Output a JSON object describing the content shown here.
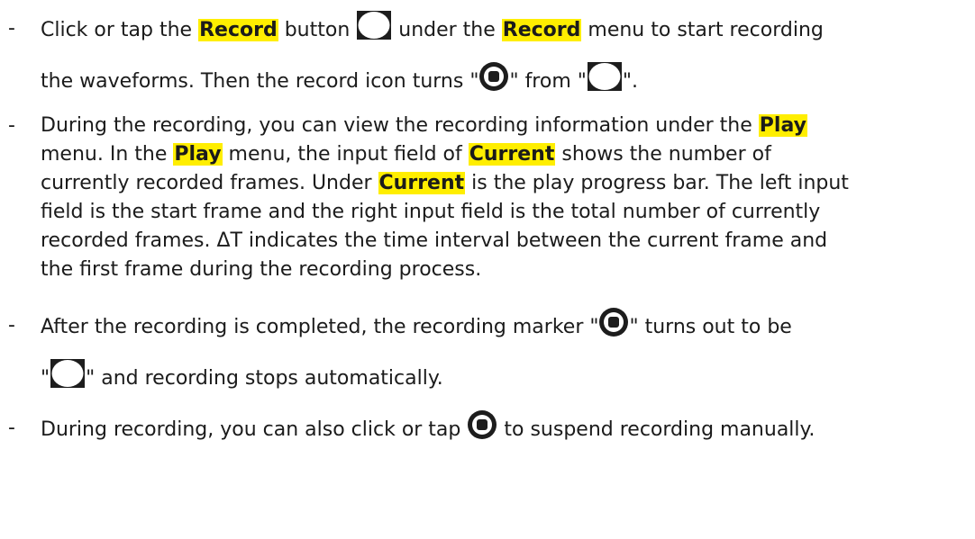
{
  "bullets": [
    {
      "lines": [
        {
          "parts": [
            "Click or tap the ",
            "Record",
            " button ",
            "",
            " under the ",
            "Record",
            " menu to start recording"
          ]
        },
        {
          "parts": [
            "the waveforms. Then the record icon turns \"",
            "",
            "\" from \"",
            "",
            "\"."
          ]
        }
      ]
    },
    {
      "lines": [
        {
          "parts": [
            "During the recording, you can view the recording information under the ",
            "Play"
          ]
        },
        {
          "parts": [
            "menu. In the ",
            "Play",
            " menu, the input field of ",
            "Current",
            " shows the number of"
          ]
        },
        {
          "parts": [
            "currently recorded frames. Under ",
            "Current",
            " is the play progress bar. The left input"
          ]
        },
        {
          "text": "field is the start frame and the right input field is the total number of currently"
        },
        {
          "text": "recorded frames. ΔT indicates the time interval between the current frame and"
        },
        {
          "text": "the first frame during the recording process."
        }
      ]
    },
    {
      "lines": [
        {
          "parts": [
            "After the recording is completed, the recording marker \"",
            "",
            "\" turns out to be"
          ]
        },
        {
          "parts": [
            "\"",
            "",
            "\" and recording stops automatically."
          ]
        }
      ]
    },
    {
      "lines": [
        {
          "parts": [
            "During recording, you can also click or tap ",
            "",
            " to suspend recording manually."
          ]
        }
      ]
    }
  ],
  "dash": "-",
  "icons": {
    "idle": "record-idle-icon",
    "active": "record-active-icon"
  },
  "colors": {
    "highlight": "#ffee00",
    "icon_fill": "#1d1d1d",
    "text": "#1b1b1b"
  }
}
